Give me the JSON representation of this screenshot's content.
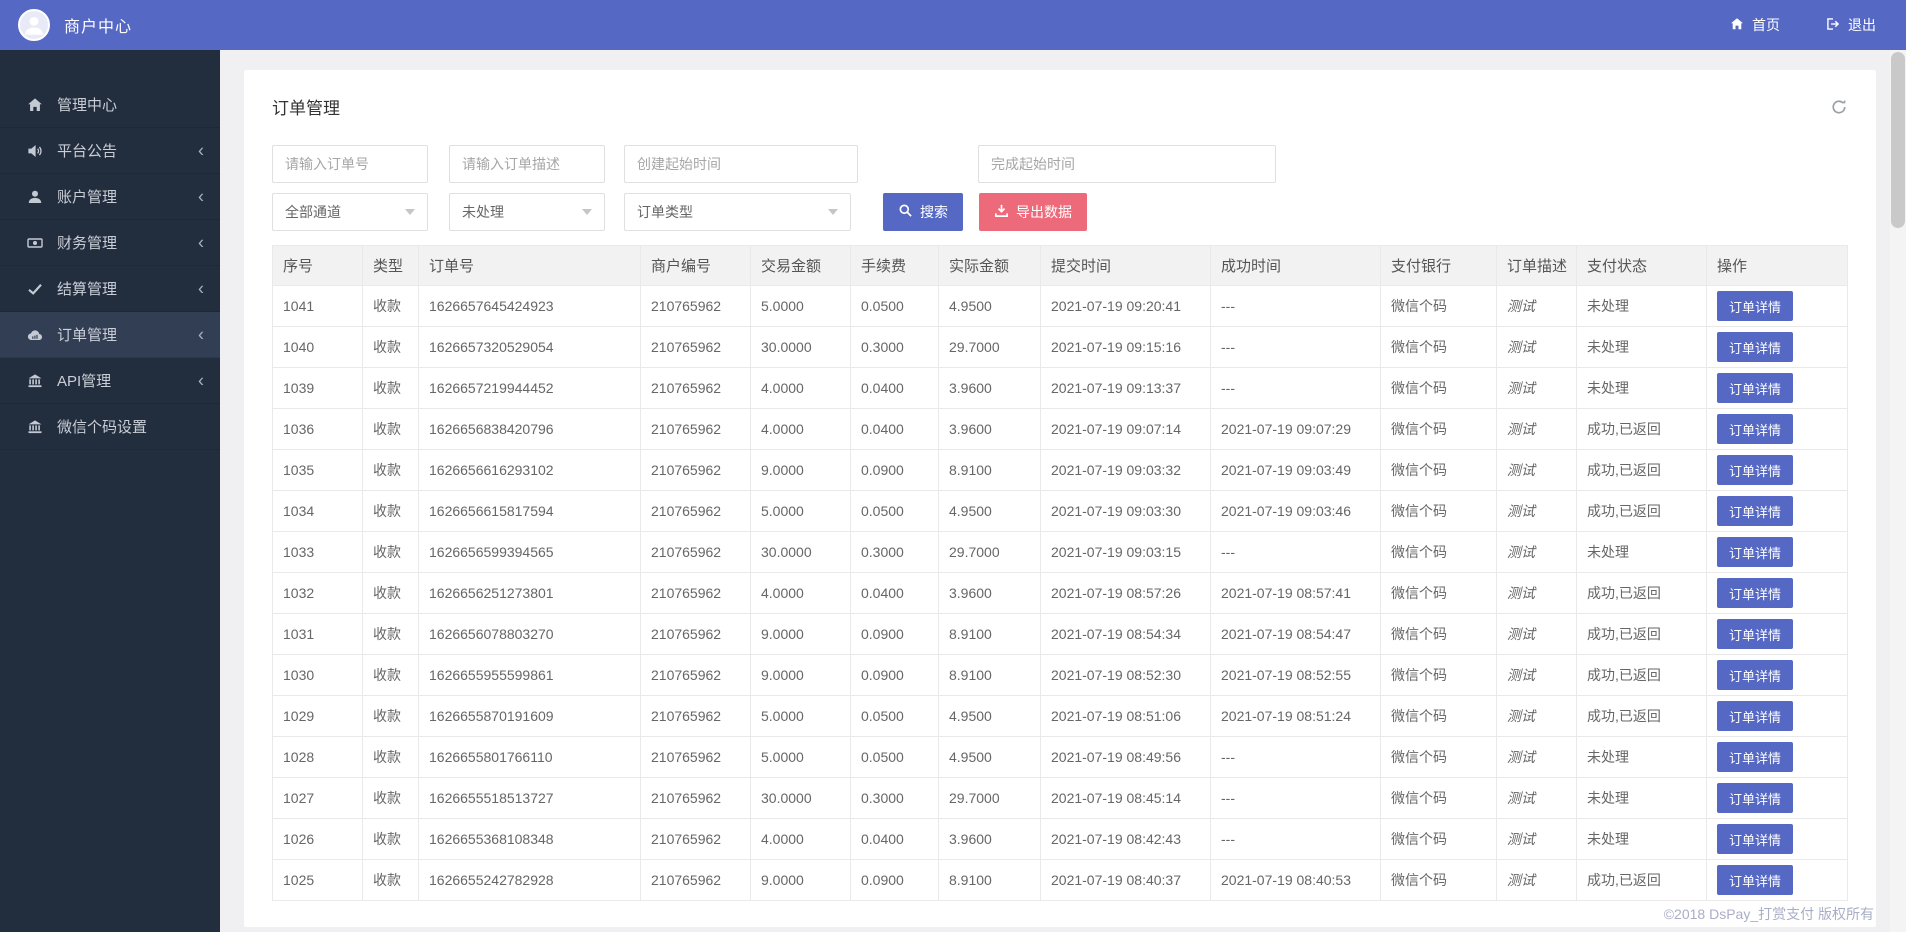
{
  "colors": {
    "accent": "#5568c4",
    "export": "#ed6a7a",
    "sidebar_bg": "#222d3d",
    "sidebar_active": "#323e54",
    "page_bg": "#f0f0f2",
    "green": "#2a9a2a",
    "red": "#f5222d",
    "border": "#e9e9e9"
  },
  "header": {
    "title": "商户中心",
    "home_label": "首页",
    "logout_label": "退出"
  },
  "sidebar": {
    "items": [
      {
        "label": "管理中心",
        "icon": "home-icon"
      },
      {
        "label": "平台公告",
        "icon": "announcement-icon"
      },
      {
        "label": "账户管理",
        "icon": "user-icon"
      },
      {
        "label": "财务管理",
        "icon": "money-icon"
      },
      {
        "label": "结算管理",
        "icon": "check-icon"
      },
      {
        "label": "订单管理",
        "icon": "order-cloud-icon",
        "active": true
      },
      {
        "label": "API管理",
        "icon": "bank-icon"
      },
      {
        "label": "微信个码设置",
        "icon": "bank-icon"
      }
    ]
  },
  "panel": {
    "title": "订单管理",
    "filters": {
      "order_no_placeholder": "请输入订单号",
      "order_desc_placeholder": "请输入订单描述",
      "create_time_placeholder": "创建起始时间",
      "finish_time_placeholder": "完成起始时间",
      "channel_select": "全部通道",
      "status_select": "未处理",
      "type_select": "订单类型",
      "search_label": "搜索",
      "export_label": "导出数据"
    },
    "table": {
      "headers": [
        "序号",
        "类型",
        "订单号",
        "商户编号",
        "交易金额",
        "手续费",
        "实际金额",
        "提交时间",
        "成功时间",
        "支付银行",
        "订单描述",
        "支付状态",
        "操作"
      ],
      "detail_label": "订单详情",
      "rows": [
        {
          "seq": "1041",
          "type": "收款",
          "order_no": "1626657645424923",
          "merchant_no": "210765962",
          "amount": "5.0000",
          "fee": "0.0500",
          "actual": "4.9500",
          "submit_time": "2021-07-19 09:20:41",
          "success_time": "---",
          "bank": "微信个码",
          "desc": "测试",
          "status": "未处理",
          "status_type": "pending"
        },
        {
          "seq": "1040",
          "type": "收款",
          "order_no": "1626657320529054",
          "merchant_no": "210765962",
          "amount": "30.0000",
          "fee": "0.3000",
          "actual": "29.7000",
          "submit_time": "2021-07-19 09:15:16",
          "success_time": "---",
          "bank": "微信个码",
          "desc": "测试",
          "status": "未处理",
          "status_type": "pending"
        },
        {
          "seq": "1039",
          "type": "收款",
          "order_no": "1626657219944452",
          "merchant_no": "210765962",
          "amount": "4.0000",
          "fee": "0.0400",
          "actual": "3.9600",
          "submit_time": "2021-07-19 09:13:37",
          "success_time": "---",
          "bank": "微信个码",
          "desc": "测试",
          "status": "未处理",
          "status_type": "pending"
        },
        {
          "seq": "1036",
          "type": "收款",
          "order_no": "1626656838420796",
          "merchant_no": "210765962",
          "amount": "4.0000",
          "fee": "0.0400",
          "actual": "3.9600",
          "submit_time": "2021-07-19 09:07:14",
          "success_time": "2021-07-19 09:07:29",
          "bank": "微信个码",
          "desc": "测试",
          "status": "成功,已返回",
          "status_type": "success"
        },
        {
          "seq": "1035",
          "type": "收款",
          "order_no": "1626656616293102",
          "merchant_no": "210765962",
          "amount": "9.0000",
          "fee": "0.0900",
          "actual": "8.9100",
          "submit_time": "2021-07-19 09:03:32",
          "success_time": "2021-07-19 09:03:49",
          "bank": "微信个码",
          "desc": "测试",
          "status": "成功,已返回",
          "status_type": "success"
        },
        {
          "seq": "1034",
          "type": "收款",
          "order_no": "1626656615817594",
          "merchant_no": "210765962",
          "amount": "5.0000",
          "fee": "0.0500",
          "actual": "4.9500",
          "submit_time": "2021-07-19 09:03:30",
          "success_time": "2021-07-19 09:03:46",
          "bank": "微信个码",
          "desc": "测试",
          "status": "成功,已返回",
          "status_type": "success"
        },
        {
          "seq": "1033",
          "type": "收款",
          "order_no": "1626656599394565",
          "merchant_no": "210765962",
          "amount": "30.0000",
          "fee": "0.3000",
          "actual": "29.7000",
          "submit_time": "2021-07-19 09:03:15",
          "success_time": "---",
          "bank": "微信个码",
          "desc": "测试",
          "status": "未处理",
          "status_type": "pending"
        },
        {
          "seq": "1032",
          "type": "收款",
          "order_no": "1626656251273801",
          "merchant_no": "210765962",
          "amount": "4.0000",
          "fee": "0.0400",
          "actual": "3.9600",
          "submit_time": "2021-07-19 08:57:26",
          "success_time": "2021-07-19 08:57:41",
          "bank": "微信个码",
          "desc": "测试",
          "status": "成功,已返回",
          "status_type": "success"
        },
        {
          "seq": "1031",
          "type": "收款",
          "order_no": "1626656078803270",
          "merchant_no": "210765962",
          "amount": "9.0000",
          "fee": "0.0900",
          "actual": "8.9100",
          "submit_time": "2021-07-19 08:54:34",
          "success_time": "2021-07-19 08:54:47",
          "bank": "微信个码",
          "desc": "测试",
          "status": "成功,已返回",
          "status_type": "success"
        },
        {
          "seq": "1030",
          "type": "收款",
          "order_no": "1626655955599861",
          "merchant_no": "210765962",
          "amount": "9.0000",
          "fee": "0.0900",
          "actual": "8.9100",
          "submit_time": "2021-07-19 08:52:30",
          "success_time": "2021-07-19 08:52:55",
          "bank": "微信个码",
          "desc": "测试",
          "status": "成功,已返回",
          "status_type": "success"
        },
        {
          "seq": "1029",
          "type": "收款",
          "order_no": "1626655870191609",
          "merchant_no": "210765962",
          "amount": "5.0000",
          "fee": "0.0500",
          "actual": "4.9500",
          "submit_time": "2021-07-19 08:51:06",
          "success_time": "2021-07-19 08:51:24",
          "bank": "微信个码",
          "desc": "测试",
          "status": "成功,已返回",
          "status_type": "success"
        },
        {
          "seq": "1028",
          "type": "收款",
          "order_no": "1626655801766110",
          "merchant_no": "210765962",
          "amount": "5.0000",
          "fee": "0.0500",
          "actual": "4.9500",
          "submit_time": "2021-07-19 08:49:56",
          "success_time": "---",
          "bank": "微信个码",
          "desc": "测试",
          "status": "未处理",
          "status_type": "pending"
        },
        {
          "seq": "1027",
          "type": "收款",
          "order_no": "1626655518513727",
          "merchant_no": "210765962",
          "amount": "30.0000",
          "fee": "0.3000",
          "actual": "29.7000",
          "submit_time": "2021-07-19 08:45:14",
          "success_time": "---",
          "bank": "微信个码",
          "desc": "测试",
          "status": "未处理",
          "status_type": "pending"
        },
        {
          "seq": "1026",
          "type": "收款",
          "order_no": "1626655368108348",
          "merchant_no": "210765962",
          "amount": "4.0000",
          "fee": "0.0400",
          "actual": "3.9600",
          "submit_time": "2021-07-19 08:42:43",
          "success_time": "---",
          "bank": "微信个码",
          "desc": "测试",
          "status": "未处理",
          "status_type": "pending"
        },
        {
          "seq": "1025",
          "type": "收款",
          "order_no": "1626655242782928",
          "merchant_no": "210765962",
          "amount": "9.0000",
          "fee": "0.0900",
          "actual": "8.9100",
          "submit_time": "2021-07-19 08:40:37",
          "success_time": "2021-07-19 08:40:53",
          "bank": "微信个码",
          "desc": "测试",
          "status": "成功,已返回",
          "status_type": "success"
        }
      ]
    }
  },
  "footer": {
    "copyright": "©2018 DsPay_打赏支付 版权所有"
  }
}
